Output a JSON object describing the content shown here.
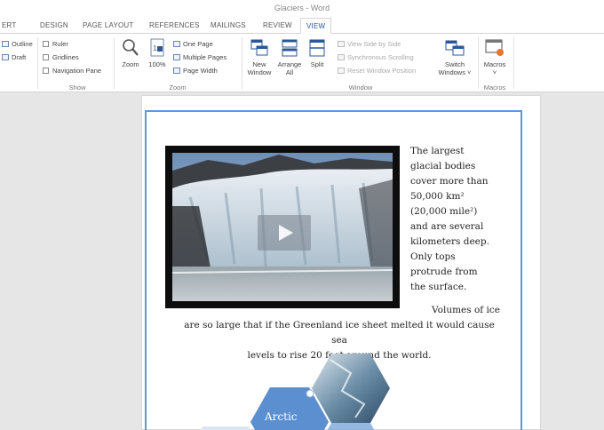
{
  "window": {
    "title": "Glaciers - Word"
  },
  "tabs": [
    {
      "label": "ERT"
    },
    {
      "label": "DESIGN"
    },
    {
      "label": "PAGE LAYOUT"
    },
    {
      "label": "REFERENCES"
    },
    {
      "label": "MAILINGS"
    },
    {
      "label": "REVIEW"
    },
    {
      "label": "VIEW",
      "active": true
    }
  ],
  "ribbon": {
    "views": {
      "outline": "Outline",
      "draft": "Draft"
    },
    "show": {
      "label": "Show",
      "ruler": "Ruler",
      "gridlines": "Gridlines",
      "navigation_pane": "Navigation Pane"
    },
    "zoom": {
      "label": "Zoom",
      "zoom": "Zoom",
      "hundred": "100%",
      "one_page": "One Page",
      "multiple_pages": "Multiple Pages",
      "page_width": "Page Width"
    },
    "window": {
      "label": "Window",
      "new_window": [
        "New",
        "Window"
      ],
      "arrange_all": [
        "Arrange",
        "All"
      ],
      "split": "Split",
      "view_side_by_side": "View Side by Side",
      "synchronous_scrolling": "Synchronous Scrolling",
      "reset_window_position": "Reset Window Position",
      "switch_windows": [
        "Switch",
        "Windows ˅"
      ]
    },
    "macros": {
      "label": "Macros",
      "button": [
        "Macros",
        "˅"
      ]
    }
  },
  "document": {
    "para1_lines": [
      "The largest",
      "glacial bodies",
      "cover more than",
      "50,000 km²",
      "(20,000 mile²)",
      "and are several",
      "kilometers deep.",
      "Only tops",
      "protrude from",
      "the surface."
    ],
    "para2_lines": [
      "Volumes of ice",
      "are so large that if the Greenland ice sheet melted it would cause sea",
      "levels to rise 20 feet around the world."
    ],
    "smartart_label": "Arctic"
  },
  "colors": {
    "accent": "#2b579a",
    "page_border": "#5b9bd5",
    "hex_fill": "#5b8fd0"
  }
}
